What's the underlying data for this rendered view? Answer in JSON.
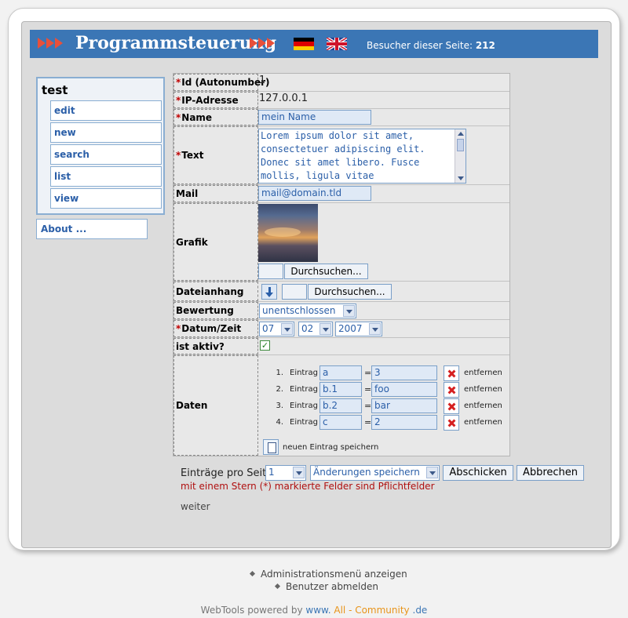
{
  "header": {
    "title": "Programmsteuerung",
    "visitors_label": "Besucher dieser Seite:",
    "visitors_count": "212",
    "accent_color": "#3b76b5",
    "arrow_color": "#e8503a"
  },
  "sidebar": {
    "title": "test",
    "items": [
      {
        "label": "edit"
      },
      {
        "label": "new"
      },
      {
        "label": "search"
      },
      {
        "label": "list"
      },
      {
        "label": "view"
      }
    ],
    "about": "About ..."
  },
  "form": {
    "id": {
      "label": "Id (Autonumber)",
      "required": "*",
      "value": "1"
    },
    "ip": {
      "label": "IP-Adresse",
      "required": "*",
      "value": "127.0.0.1"
    },
    "name": {
      "label": "Name",
      "required": "*",
      "value": "mein Name"
    },
    "text": {
      "label": "Text",
      "required": "*",
      "lines": [
        "Lorem ipsum dolor sit amet,",
        "consectetuer adipiscing elit.",
        "Donec sit amet libero. Fusce",
        "mollis, ligula vitae"
      ]
    },
    "mail": {
      "label": "Mail",
      "value": "mail@domain.tld"
    },
    "grafik": {
      "label": "Grafik",
      "browse_label": "Durchsuchen..."
    },
    "attachment": {
      "label": "Dateianhang",
      "browse_label": "Durchsuchen..."
    },
    "rating": {
      "label": "Bewertung",
      "value": "unentschlossen"
    },
    "datetime": {
      "label": "Datum/Zeit",
      "required": "*",
      "day": "07",
      "month": "02",
      "year": "2007"
    },
    "active": {
      "label": "ist aktiv?",
      "checked_glyph": "✓"
    },
    "data": {
      "label": "Daten",
      "entry_label": "Eintrag",
      "equals": "=",
      "remove_label": "entfernen",
      "entries": [
        {
          "num": "1.",
          "key": "a",
          "value": "3"
        },
        {
          "num": "2.",
          "key": "b.1",
          "value": "foo"
        },
        {
          "num": "3.",
          "key": "b.2",
          "value": "bar"
        },
        {
          "num": "4.",
          "key": "c",
          "value": "2"
        }
      ],
      "save_entry": "neuen Eintrag speichern"
    }
  },
  "bottom": {
    "per_page_label": "Einträge pro Seite",
    "per_page_value": "1",
    "action_value": "Änderungen speichern",
    "submit": "Abschicken",
    "cancel": "Abbrechen",
    "required_note": "mit einem Stern (*) markierte Felder sind Pflichtfelder",
    "next": "weiter"
  },
  "footer": {
    "admin_menu": "Administrationsmenü anzeigen",
    "logout": "Benutzer abmelden",
    "credits_prefix": "WebTools powered by",
    "credits_www": "www.",
    "credits_all": "All - Community",
    "credits_tld": ".de"
  }
}
